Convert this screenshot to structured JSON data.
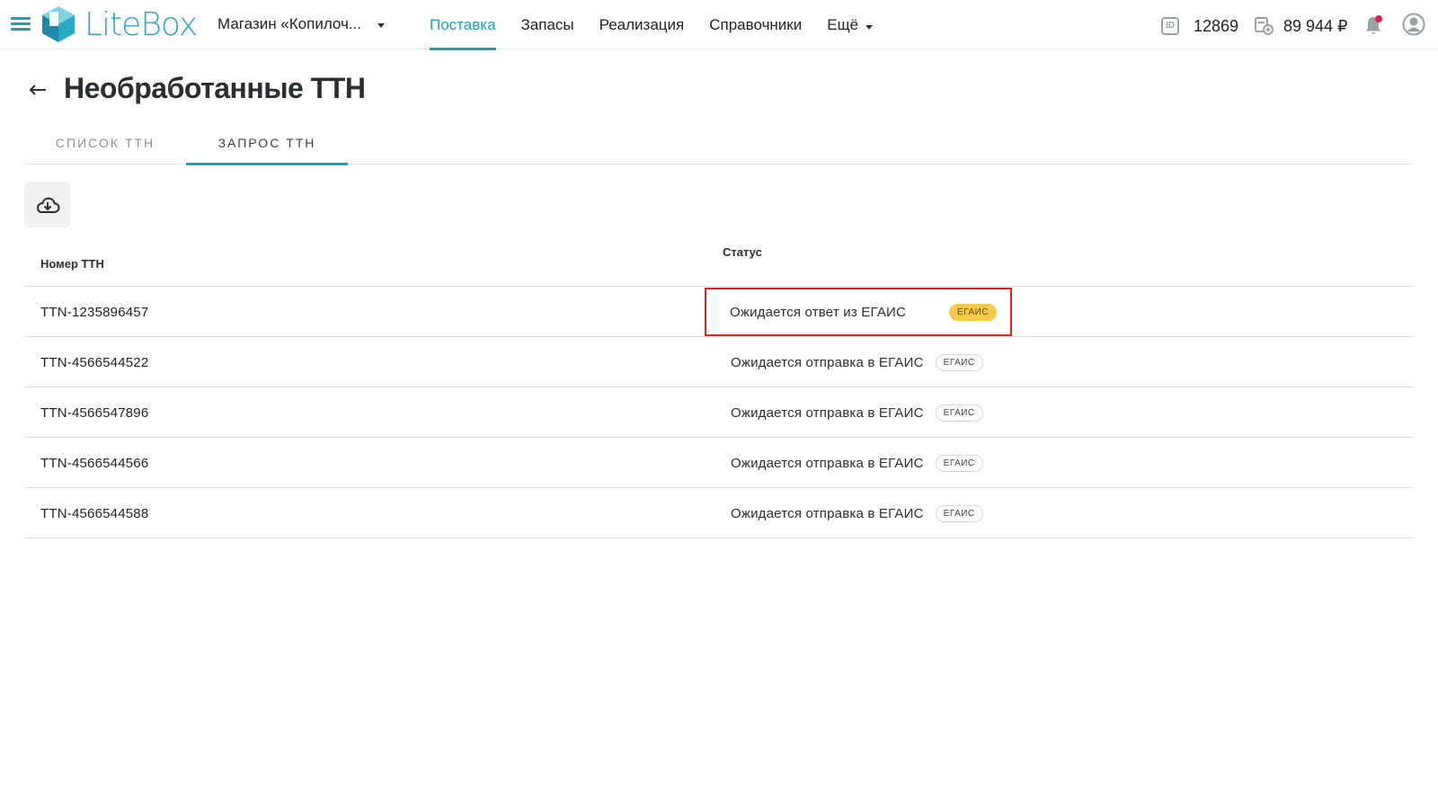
{
  "header": {
    "logo_text": "LiteBox",
    "store_name": "Магазин «Копилоч...",
    "nav": [
      {
        "label": "Поставка",
        "active": true
      },
      {
        "label": "Запасы",
        "active": false
      },
      {
        "label": "Реализация",
        "active": false
      },
      {
        "label": "Справочники",
        "active": false
      },
      {
        "label": "Ещё",
        "active": false
      }
    ],
    "id_badge": "ID",
    "account_id": "12869",
    "balance": "89 944 ₽",
    "accent_color": "#1aa3b8",
    "notification_dot_color": "#e0204a"
  },
  "page": {
    "title": "Необработанные ТТН",
    "tabs": [
      {
        "label": "СПИСОК ТТН",
        "active": false
      },
      {
        "label": "ЗАПРОС ТТН",
        "active": true
      }
    ]
  },
  "table": {
    "columns": {
      "number": "Номер ТТН",
      "status": "Статус"
    },
    "rows": [
      {
        "number": "TTN-1235896457",
        "status": "Ожидается ответ из ЕГАИС",
        "badge": "ЕГАИС",
        "badge_color": "#f7c948",
        "highlighted": true
      },
      {
        "number": "TTN-4566544522",
        "status": "Ожидается отправка в ЕГАИС",
        "badge": "ЕГАИС",
        "highlighted": false
      },
      {
        "number": "TTN-4566547896",
        "status": "Ожидается отправка в ЕГАИС",
        "badge": "ЕГАИС",
        "highlighted": false
      },
      {
        "number": "TTN-4566544566",
        "status": "Ожидается отправка в ЕГАИС",
        "badge": "ЕГАИС",
        "highlighted": false
      },
      {
        "number": "TTN-4566544588",
        "status": "Ожидается отправка в ЕГАИС",
        "badge": "ЕГАИС",
        "highlighted": false
      }
    ]
  },
  "icons": [
    "menu-icon",
    "litebox-logo-icon",
    "chevron-down-icon",
    "id-icon",
    "balance-icon",
    "bell-icon",
    "user-avatar-icon",
    "back-arrow-icon",
    "cloud-download-icon"
  ]
}
